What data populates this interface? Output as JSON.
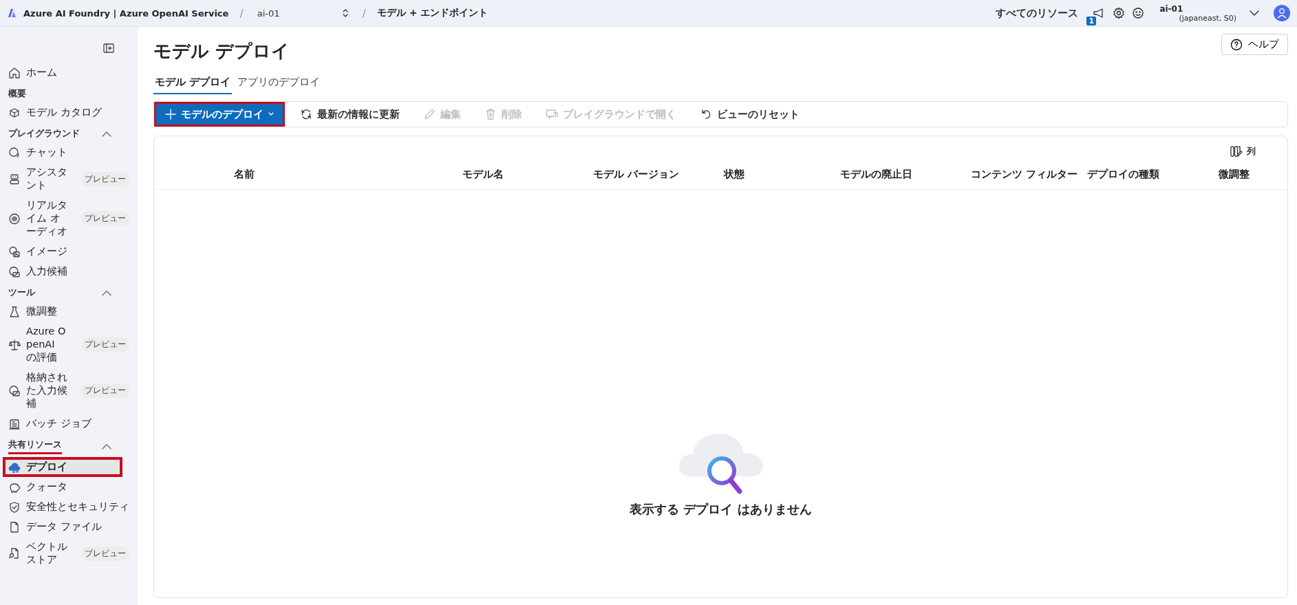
{
  "topbar": {
    "brand": "Azure AI Foundry | Azure OpenAI Service",
    "project": "ai-01",
    "breadcrumb": "モデル + エンドポイント",
    "separators": [
      "/",
      "/"
    ],
    "resources_link": "すべてのリソース",
    "notification_count": "1",
    "account_name": "ai-01",
    "account_detail": "(japaneast, S0)"
  },
  "sidebar": {
    "groups": [
      {
        "items": [
          {
            "label": "ホーム",
            "selected": false,
            "highlighted": false
          }
        ]
      },
      {
        "title": "概要",
        "items": [
          {
            "label": "モデル カタログ",
            "selected": false,
            "highlighted": false
          }
        ]
      },
      {
        "title": "プレイグラウンド",
        "expanded": true,
        "items": [
          {
            "label": "チャット",
            "selected": false,
            "highlighted": false
          },
          {
            "label": "アシスタント",
            "badge": "プレビュー",
            "selected": false,
            "highlighted": false
          },
          {
            "label": "リアルタイム オーディオ",
            "badge": "プレビュー",
            "selected": false,
            "highlighted": false
          },
          {
            "label": "イメージ",
            "selected": false,
            "highlighted": false
          },
          {
            "label": "入力候補",
            "selected": false,
            "highlighted": false
          }
        ]
      },
      {
        "title": "ツール",
        "expanded": true,
        "items": [
          {
            "label": "微調整",
            "selected": false,
            "highlighted": false
          },
          {
            "label": "Azure OpenAI の評価",
            "badge": "プレビュー",
            "selected": false,
            "highlighted": false
          },
          {
            "label": "格納された入力候補",
            "badge": "プレビュー",
            "selected": false,
            "highlighted": false
          },
          {
            "label": "バッチ ジョブ",
            "selected": false,
            "highlighted": false
          }
        ]
      },
      {
        "title": "共有リソース",
        "expanded": true,
        "underlined": true,
        "items": [
          {
            "label": "デプロイ",
            "selected": true,
            "highlighted": true
          },
          {
            "label": "クォータ",
            "selected": false,
            "highlighted": false
          },
          {
            "label": "安全性とセキュリティ",
            "selected": false,
            "highlighted": false
          },
          {
            "label": "データ ファイル",
            "selected": false,
            "highlighted": false
          },
          {
            "label": "ベクトルストア",
            "badge": "プレビュー",
            "selected": false,
            "highlighted": false
          }
        ]
      }
    ]
  },
  "page": {
    "title": "モデル デプロイ",
    "help_button": "ヘルプ"
  },
  "tabs": [
    {
      "label": "モデル デプロイ",
      "selected": true
    },
    {
      "label": "アプリのデプロイ",
      "selected": false
    }
  ],
  "toolbar": [
    {
      "label": "モデルのデプロイ",
      "kind": "primary",
      "disabled": false,
      "highlighted": true
    },
    {
      "label": "最新の情報に更新",
      "kind": "plain",
      "disabled": false,
      "highlighted": false
    },
    {
      "label": "編集",
      "kind": "plain",
      "disabled": true,
      "highlighted": false
    },
    {
      "label": "削除",
      "kind": "plain",
      "disabled": true,
      "highlighted": false
    },
    {
      "label": "プレイグラウンドで開く",
      "kind": "plain",
      "disabled": true,
      "highlighted": false
    },
    {
      "label": "ビューのリセット",
      "kind": "plain",
      "disabled": false,
      "highlighted": false
    }
  ],
  "table": {
    "columns_button": "列",
    "columns": [
      "名前",
      "モデル名",
      "モデル バージョン",
      "状態",
      "モデルの廃止日",
      "コンテンツ フィルター",
      "デプロイの種類",
      "微調整"
    ],
    "empty_message": "表示する デプロイ はありません"
  }
}
